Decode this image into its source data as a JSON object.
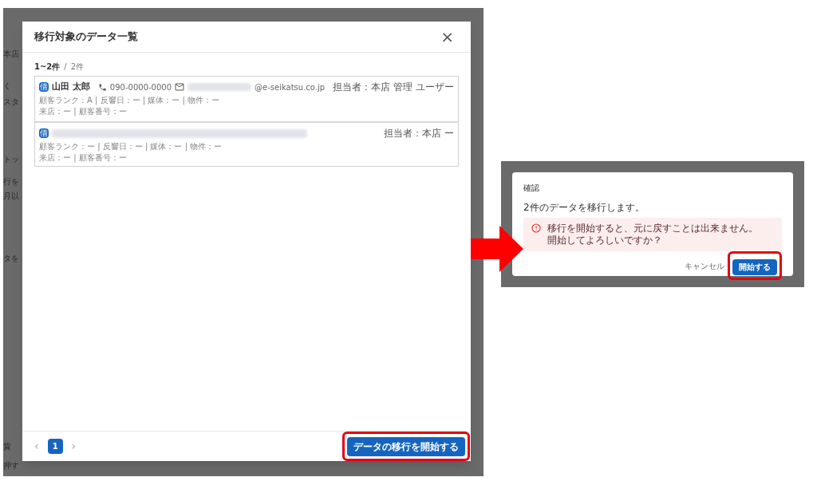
{
  "background_fragments": [
    "本店",
    "く",
    "スタ",
    "トッ",
    "行を",
    "月以",
    "タを",
    "貨",
    "押す"
  ],
  "list_modal": {
    "title": "移行対象のデータ一覧",
    "close": "×",
    "range": "1~2件",
    "separator": "/",
    "total": "2件",
    "records": [
      {
        "badge": "借",
        "name": "山田 太郎",
        "phone": "090-0000-0000",
        "name_redacted": false,
        "email_domain": "@e-seikatsu.co.jp",
        "staff": "担当者：本店 管理 ユーザー",
        "details": "顧客ランク：A | 反響日：ー | 媒体：ー | 物件：ー",
        "details2": "来店：ー | 顧客番号：ー"
      },
      {
        "badge": "借",
        "name_redacted": true,
        "staff": "担当者：本店 ー",
        "details": "顧客ランク：ー | 反響日：ー | 媒体：ー | 物件：ー",
        "details2": "来店：ー | 顧客番号：ー"
      }
    ],
    "pagination": {
      "prev": "‹",
      "next": "›",
      "pages": [
        {
          "label": "1",
          "selected": true
        }
      ]
    },
    "start_button": {
      "label": "データの移行を開始する",
      "highlighted": true
    }
  },
  "confirm_dialog": {
    "title": "確認",
    "message": "2件のデータを移行します。",
    "warning": [
      "移行を開始すると、元に戻すことは出来ません。",
      "開始してよろしいですか？"
    ],
    "cancel": "キャンセル",
    "ok": {
      "label": "開始する",
      "highlighted": true
    }
  }
}
